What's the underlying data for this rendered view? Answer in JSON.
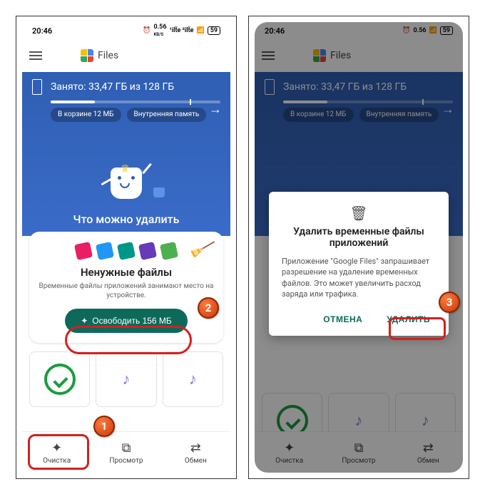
{
  "status": {
    "time": "20:46",
    "net": "0.56",
    "net_unit": "KB/S",
    "battery": "59"
  },
  "app": {
    "name": "Files"
  },
  "storage": {
    "text": "Занято: 33,47 ГБ из 128 ГБ",
    "chip_trash": "В корзине 12 МБ",
    "chip_internal": "Внутренняя память"
  },
  "hero": {
    "title": "Что можно удалить"
  },
  "junk_card": {
    "title": "Ненужные файлы",
    "subtitle": "Временные файлы приложений занимают место на устройстве.",
    "button": "Освободить 156 МБ"
  },
  "nav": {
    "clean": "Очистка",
    "browse": "Просмотр",
    "share": "Обмен"
  },
  "dialog": {
    "title": "Удалить временные файлы приложений",
    "body": "Приложение \"Google Files\" запрашивает разрешение на удаление временных файлов. Это может увеличить расход заряда или трафика.",
    "cancel": "ОТМЕНА",
    "confirm": "УДАЛИТЬ"
  },
  "markers": {
    "m1": "1",
    "m2": "2",
    "m3": "3"
  }
}
